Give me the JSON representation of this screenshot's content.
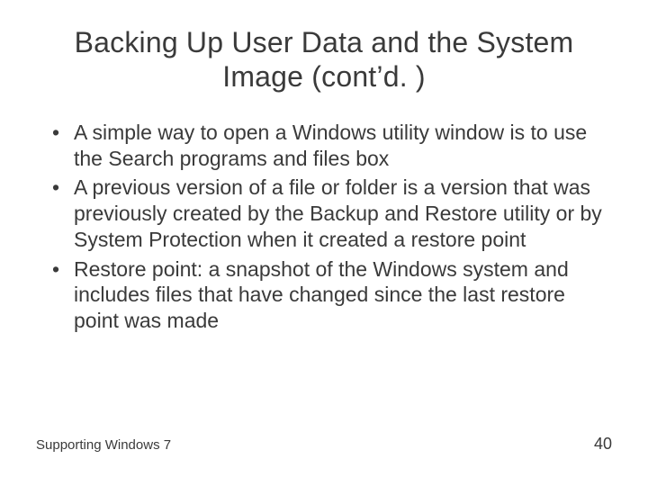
{
  "slide": {
    "title": "Backing Up User Data and the System Image (cont’d. )",
    "bullets": [
      "A simple way to open a Windows utility window is to use the Search programs and files box",
      "A previous version of a file or folder is a version that was previously created by the Backup and Restore utility or by System Protection when it created a restore point",
      "Restore point: a snapshot of the Windows system and includes files that have changed since the last restore point was made"
    ],
    "footer_left": "Supporting Windows 7",
    "footer_right": "40"
  }
}
